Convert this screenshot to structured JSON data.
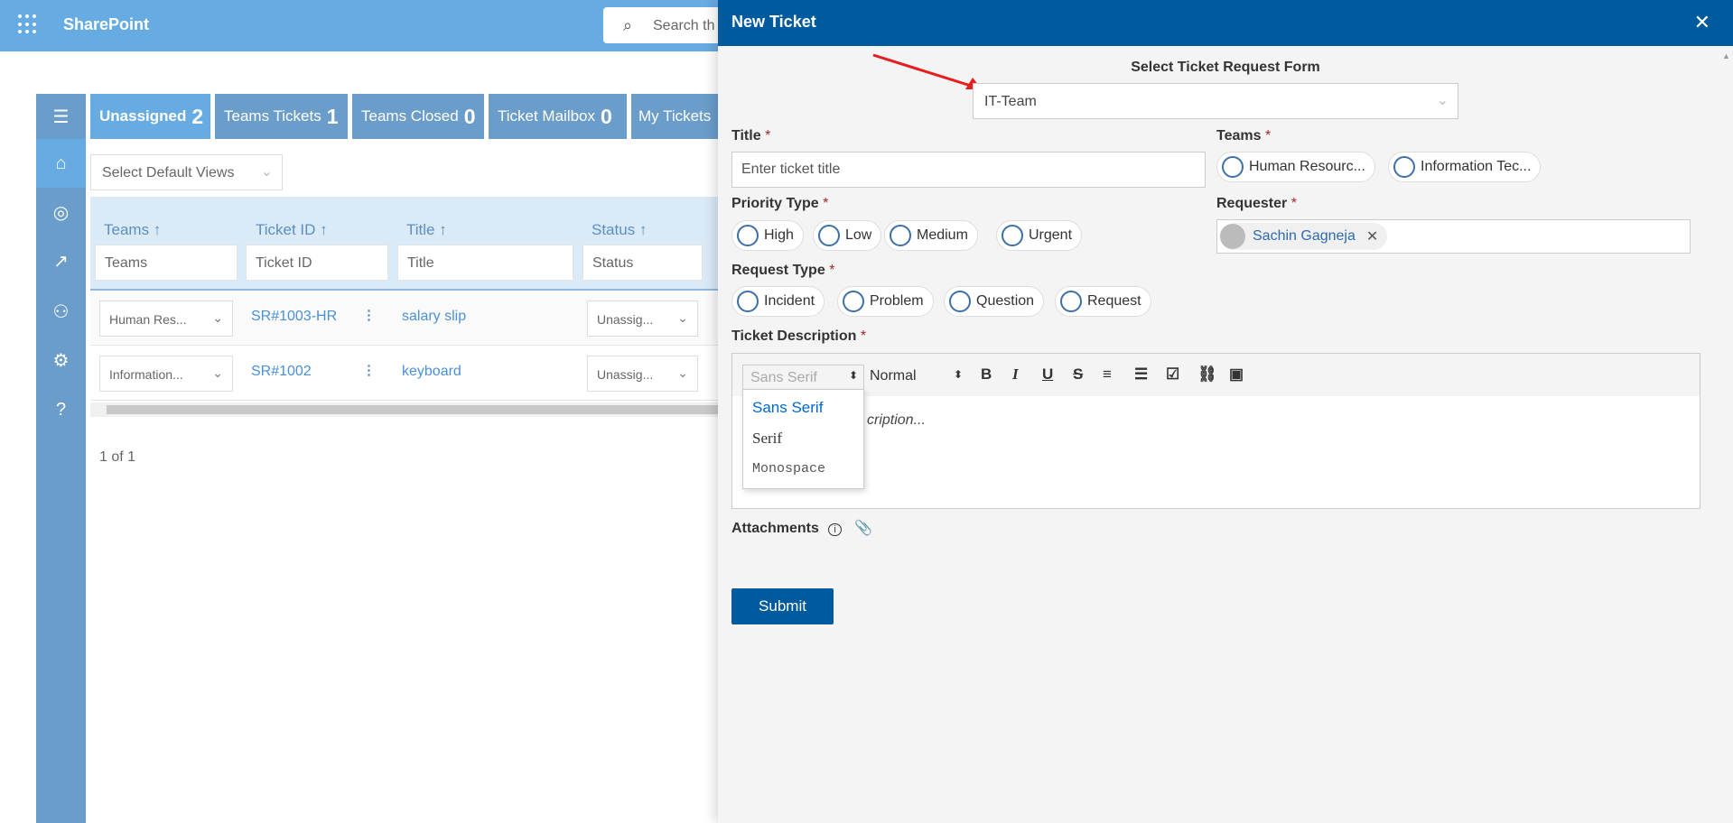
{
  "app": {
    "name": "SharePoint",
    "search_placeholder": "Search th"
  },
  "nav": {
    "icons": [
      "menu-icon",
      "home-icon",
      "dashboard-icon",
      "chart-icon",
      "users-icon",
      "settings-icon",
      "help-icon"
    ]
  },
  "tabs": [
    {
      "label": "Unassigned",
      "count": "2"
    },
    {
      "label": "Teams Tickets",
      "count": "1"
    },
    {
      "label": "Teams Closed",
      "count": "0"
    },
    {
      "label": "Ticket Mailbox",
      "count": "0"
    },
    {
      "label": "My Tickets",
      "count": ""
    }
  ],
  "views": {
    "placeholder": "Select Default Views"
  },
  "table": {
    "columns": [
      "Teams",
      "Ticket ID",
      "Title",
      "Status"
    ],
    "filters": [
      "Teams",
      "Ticket ID",
      "Title",
      "Status"
    ],
    "rows": [
      {
        "team": "Human Res...",
        "id": "SR#1003-HR",
        "title": "salary slip",
        "status": "Unassig..."
      },
      {
        "team": "Information...",
        "id": "SR#1002",
        "title": "keyboard",
        "status": "Unassig..."
      }
    ],
    "pager": "1 of 1"
  },
  "panel": {
    "title": "New Ticket",
    "form_select_label": "Select Ticket Request Form",
    "form_select_value": "IT-Team",
    "title_label": "Title",
    "title_placeholder": "Enter ticket title",
    "teams_label": "Teams",
    "teams": [
      "Human Resourc...",
      "Information Tec..."
    ],
    "priority_label": "Priority Type",
    "priorities": [
      "High",
      "Low",
      "Medium",
      "Urgent"
    ],
    "requester_label": "Requester",
    "requester": "Sachin Gagneja",
    "request_type_label": "Request Type",
    "request_types": [
      "Incident",
      "Problem",
      "Question",
      "Request"
    ],
    "description_label": "Ticket Description",
    "description_placeholder": "cription...",
    "font_value": "Sans Serif",
    "size_value": "Normal",
    "font_options": [
      "Sans Serif",
      "Serif",
      "Monospace"
    ],
    "attachments_label": "Attachments",
    "submit": "Submit",
    "required_mark": "*"
  },
  "colors": {
    "header": "#67abe3",
    "panel_header": "#005a9e",
    "accent": "#4a90d9",
    "annotation_arrow": "#e81c1c"
  }
}
